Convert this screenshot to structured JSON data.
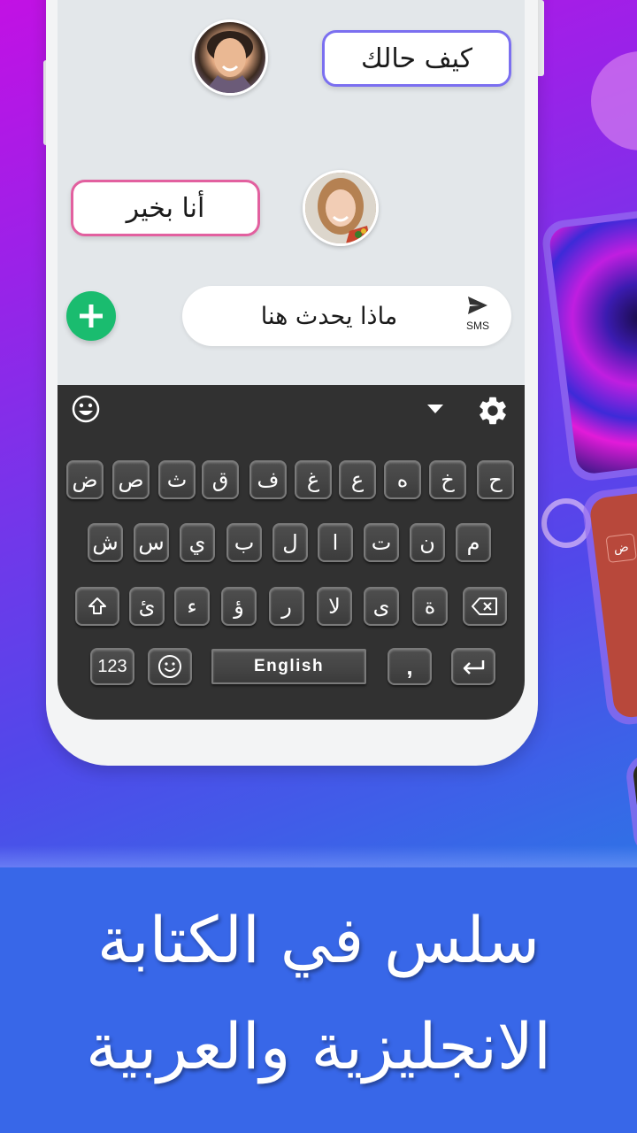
{
  "chat": {
    "incoming_message": "كيف حالك",
    "outgoing_message": "أنا بخير",
    "compose_text": "ماذا يحدث هنا",
    "send_label": "SMS",
    "add_button_symbol": "+"
  },
  "avatars": {
    "male": "male-avatar",
    "female": "female-avatar"
  },
  "keyboard": {
    "toolbar": {
      "emoji_icon": "emoji-icon",
      "collapse_icon": "chevron-down-icon",
      "settings_icon": "gear-icon"
    },
    "row1": [
      "ض",
      "ص",
      "ث",
      "ق",
      "ف",
      "غ",
      "ع",
      "ه",
      "خ",
      "ح"
    ],
    "row2": [
      "ش",
      "س",
      "ي",
      "ب",
      "ل",
      "ا",
      "ت",
      "ن",
      "م"
    ],
    "row3": [
      "ئ",
      "ء",
      "ؤ",
      "ر",
      "لا",
      "ى",
      "ة"
    ],
    "bottom": {
      "numbers_label": "123",
      "space_label": "English",
      "comma_label": ","
    }
  },
  "side_cards": {
    "mini_key": "ض"
  },
  "banner": {
    "line1": "سلس في الكتابة",
    "line2": "الانجليزية والعربية"
  },
  "colors": {
    "incoming_border": "#7b6ff0",
    "outgoing_border": "#e2609f",
    "add_button": "#1abc6f",
    "keyboard_bg": "#313131",
    "banner_bg": "#3867e8"
  }
}
